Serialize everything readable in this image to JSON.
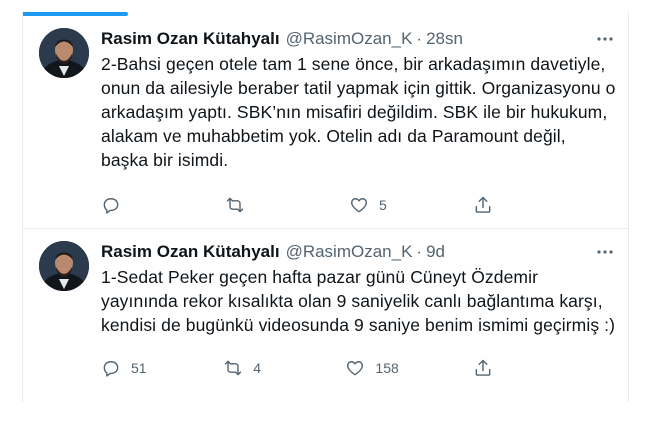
{
  "tweets": [
    {
      "name": "Rasim Ozan Kütahyalı",
      "handle": "@RasimOzan_K",
      "separator": "·",
      "time": "28sn",
      "text": "2-Bahsi geçen otele tam 1 sene önce, bir arkadaşımın davetiyle, onun da ailesiyle beraber tatil yapmak için gittik. Organizasyonu o arkadaşım yaptı. SBK’nın misafiri değildim. SBK ile bir hukukum, alakam ve muhabbetim yok. Otelin adı da Paramount değil, başka bir isimdi.",
      "reply_count": "",
      "retweet_count": "",
      "like_count": "5"
    },
    {
      "name": "Rasim Ozan Kütahyalı",
      "handle": "@RasimOzan_K",
      "separator": "·",
      "time": "9d",
      "text": "1-Sedat Peker geçen hafta pazar günü Cüneyt Özdemir yayınında rekor kısalıkta olan 9 saniyelik canlı bağlantıma karşı, kendisi de bugünkü videosunda 9 saniye benim ismimi geçirmiş :)",
      "reply_count": "51",
      "retweet_count": "4",
      "like_count": "158"
    }
  ],
  "icons": {
    "more": "more-horizontal-icon",
    "reply": "reply-icon",
    "retweet": "retweet-icon",
    "like": "heart-icon",
    "share": "share-icon"
  },
  "colors": {
    "accent": "#1d9bf0",
    "text": "#0f1419",
    "secondary": "#536471",
    "divider": "#e6ecf0"
  }
}
